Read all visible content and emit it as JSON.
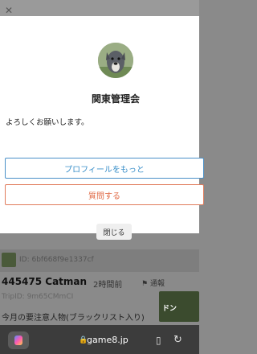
{
  "background": {
    "id_text": "ID: 6bf668f9e1337cf",
    "title": "445475 Catman",
    "time": "2時間前",
    "report": "通報",
    "trip": "TripID: 9m65CMmCI",
    "warning": "今月の要注意人物(ブラックリスト入り)",
    "ad_text": "ドン"
  },
  "modal": {
    "title": "関東管理会",
    "message": "よろしくお願いします。",
    "profile_button": "プロフィールをもっと",
    "question_button": "質問する",
    "close_button": "閉じる"
  },
  "browser": {
    "url": "game8.jp"
  },
  "colors": {
    "profile_accent": "#3a8fc9",
    "question_accent": "#e06a45"
  }
}
